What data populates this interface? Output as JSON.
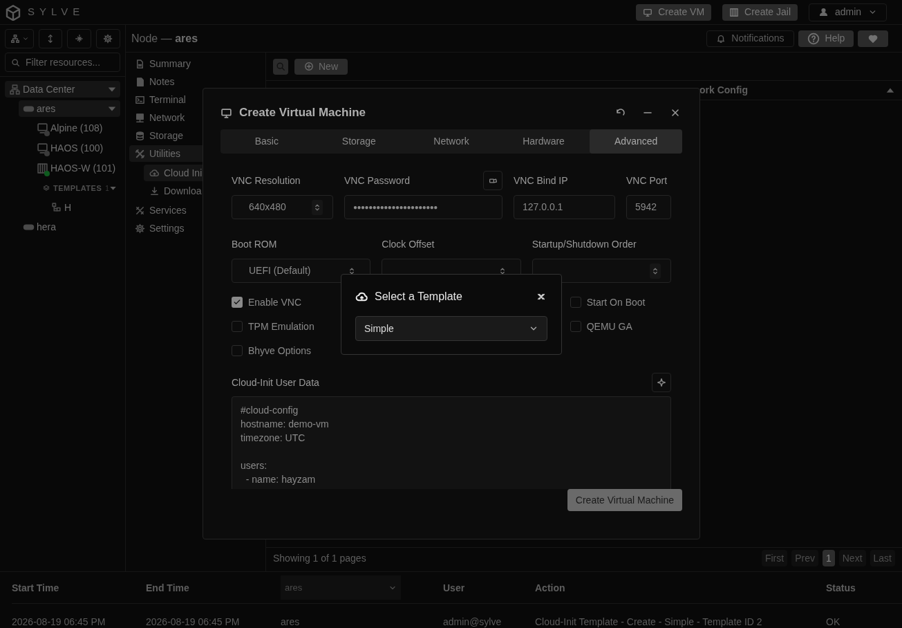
{
  "app": {
    "logo": "SYLVE"
  },
  "top_actions": [
    {
      "label": "Create VM"
    },
    {
      "label": "Create Jail"
    }
  ],
  "user_menu": {
    "label": "admin"
  },
  "sidebar": {
    "filter_placeholder": "Filter resources...",
    "tree": [
      {
        "label": "Data Center",
        "kind": "datacenter",
        "expanded": true,
        "selected": true,
        "children": [
          {
            "label": "ares",
            "kind": "node",
            "expanded": true,
            "selected": true,
            "children": [
              {
                "label": "Alpine (108)",
                "kind": "vm",
                "color": "#3a3a3a",
                "selected": false
              },
              {
                "label": "HAOS (100)",
                "kind": "vm",
                "color": "#3a3a3a",
                "selected": false
              },
              {
                "label": "HAOS-W (101)",
                "kind": "jail",
                "color": "#0f5a1f",
                "selected": false
              },
              {
                "label": "TEMPLATES",
                "count": "1",
                "kind": "group",
                "expanded": true,
                "selected": false,
                "children": [
                  {
                    "label": "H",
                    "kind": "template",
                    "selected": false
                  }
                ]
              }
            ]
          },
          {
            "label": "hera",
            "kind": "node",
            "selected": false
          }
        ]
      }
    ]
  },
  "header": {
    "title": "Node — **ares**",
    "actions": [
      {
        "label": "Notifications"
      },
      {
        "label": "Help"
      },
      {
        "kind": "favorite"
      }
    ]
  },
  "nav": [
    {
      "label": "Summary",
      "selected": false
    },
    {
      "label": "Notes",
      "selected": false
    },
    {
      "label": "Terminal",
      "selected": false
    },
    {
      "label": "Network",
      "selected": false
    },
    {
      "label": "Storage",
      "selected": false
    },
    {
      "label": "Utilities",
      "selected": true,
      "children": [
        {
          "label": "Cloud Ini",
          "selected": true
        },
        {
          "label": "Downloa",
          "selected": false
        }
      ]
    },
    {
      "label": "Services",
      "selected": false
    },
    {
      "label": "Settings",
      "selected": false
    }
  ],
  "content": {
    "new_button": "New",
    "table": {
      "columns": [
        "ork Config"
      ]
    },
    "pagination": {
      "summary": "Showing 1 of 1 pages",
      "buttons": [
        {
          "label": "First",
          "disabled": true,
          "selected": false
        },
        {
          "label": "Prev",
          "disabled": true,
          "selected": false
        },
        {
          "label": "1",
          "disabled": false,
          "selected": true
        },
        {
          "label": "Next",
          "disabled": true,
          "selected": false
        },
        {
          "label": "Last",
          "disabled": true,
          "selected": false
        }
      ]
    }
  },
  "logs": {
    "columns": [
      {
        "label": "Start Time",
        "kind": "text"
      },
      {
        "label": "End Time",
        "kind": "text"
      },
      {
        "label": "ares",
        "kind": "select"
      },
      {
        "label": "User",
        "kind": "text"
      },
      {
        "label": "Action",
        "kind": "text"
      },
      {
        "label": "Status",
        "kind": "text"
      }
    ],
    "rows": [
      [
        "2026-08-19 06:45 PM",
        "2026-08-19 06:45 PM",
        "ares",
        "admin@sylve",
        "Cloud-Init Template - Create - Simple - Template ID 2",
        "OK"
      ]
    ]
  },
  "modal": {
    "title": "Create Virtual Machine",
    "tabs": [
      {
        "label": "Basic",
        "selected": false
      },
      {
        "label": "Storage",
        "selected": false
      },
      {
        "label": "Network",
        "selected": false
      },
      {
        "label": "Hardware",
        "selected": false
      },
      {
        "label": "Advanced",
        "selected": true
      }
    ],
    "row1": [
      {
        "label": "VNC Resolution",
        "value": "640x480",
        "kind": "stepper"
      },
      {
        "label": "VNC Password",
        "value": "●●●●●●●●●●●●●●●●●●●●●●",
        "kind": "password"
      },
      {
        "label": "VNC Bind IP",
        "value": "127.0.0.1",
        "kind": "text"
      },
      {
        "label": "VNC Port",
        "value": "5942",
        "kind": "text"
      }
    ],
    "row2": [
      {
        "label": "Boot ROM",
        "value": "UEFI (Default)",
        "kind": "select"
      },
      {
        "label": "Clock Offset",
        "kind": "select"
      },
      {
        "label": "Startup/Shutdown Order",
        "kind": "stepper"
      }
    ],
    "checkboxes_left": [
      {
        "label": "Enable VNC",
        "checked": true
      },
      {
        "label": "TPM Emulation",
        "checked": false
      },
      {
        "label": "Bhyve Options",
        "checked": false
      }
    ],
    "checkboxes_right": [
      {
        "label": "Start On Boot",
        "checked": false
      },
      {
        "label": "QEMU GA",
        "checked": false
      }
    ],
    "cloud_init": {
      "label": "Cloud-Init User Data",
      "value": "#cloud-config\nhostname: demo-vm\ntimezone: UTC\n\nusers:\n  - name: hayzam"
    },
    "submit": "Create Virtual Machine"
  },
  "template_dialog": {
    "title": "Select a Template",
    "value": "Simple"
  }
}
